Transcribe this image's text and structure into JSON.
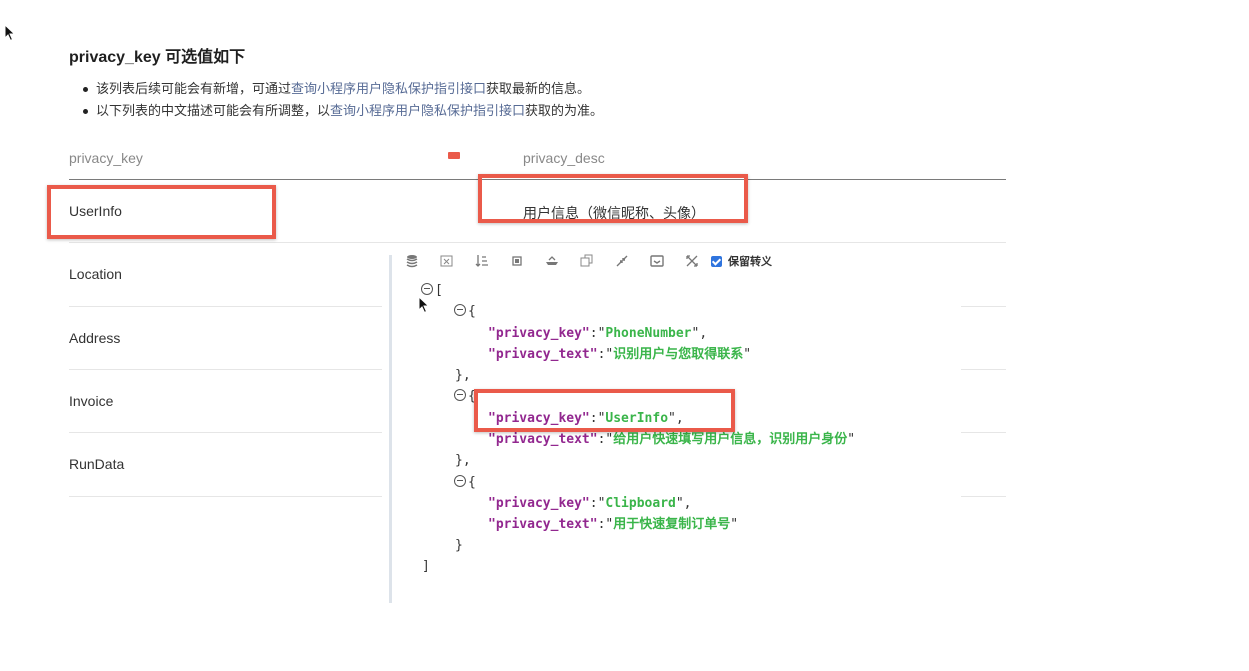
{
  "heading": "privacy_key 可选值如下",
  "bullets": [
    {
      "pre": "该列表后续可能会有新增，可通过",
      "link": "查询小程序用户隐私保护指引接口",
      "post": "获取最新的信息。"
    },
    {
      "pre": "以下列表的中文描述可能会有所调整，以",
      "link": "查询小程序用户隐私保护指引接口",
      "post": "获取的为准。"
    }
  ],
  "table": {
    "headers": [
      "privacy_key",
      "privacy_desc"
    ],
    "rows": [
      {
        "key": "UserInfo",
        "desc": "用户信息（微信昵称、头像）"
      },
      {
        "key": "Location",
        "desc": ""
      },
      {
        "key": "Address",
        "desc": ""
      },
      {
        "key": "Invoice",
        "desc": ""
      },
      {
        "key": "RunData",
        "desc": ""
      }
    ]
  },
  "json_viewer": {
    "toolbar_icons": [
      "database-icon",
      "clear-icon",
      "sort-icon",
      "compact-icon",
      "format-icon",
      "copy-icon",
      "collapse-icon",
      "save-icon",
      "expand-icon"
    ],
    "keep_escape_label": "保留转义",
    "keep_escape_checked": true,
    "items": [
      {
        "privacy_key": "PhoneNumber",
        "privacy_text": "识别用户与您取得联系"
      },
      {
        "privacy_key": "UserInfo",
        "privacy_text": "给用户快速填写用户信息，识别用户身份"
      },
      {
        "privacy_key": "Clipboard",
        "privacy_text": "用于快速复制订单号"
      }
    ],
    "key_names": {
      "key": "\"privacy_key\"",
      "text": "\"privacy_text\""
    }
  },
  "colors": {
    "highlight": "#ea5a4a",
    "link": "#576b95",
    "json_key": "#92278f",
    "json_string": "#3ab54a"
  }
}
